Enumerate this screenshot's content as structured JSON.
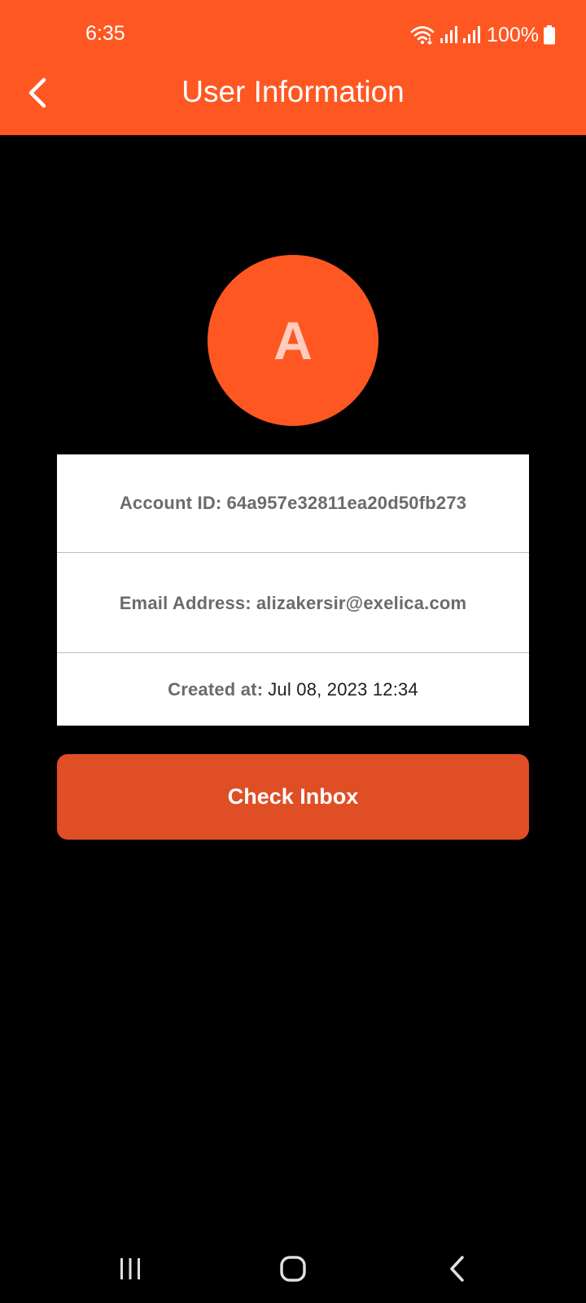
{
  "status_bar": {
    "time": "6:35",
    "battery_percent": "100%"
  },
  "app_bar": {
    "title": "User Information",
    "back_icon": "chevron-left-icon"
  },
  "avatar": {
    "letter": "A"
  },
  "info": {
    "account_label": "Account ID:",
    "account_value": "64a957e32811ea20d50fb273",
    "email_label": "Email Address:",
    "email_value": "alizakersir@exelica.com",
    "created_label": "Created at:",
    "created_value": "Jul 08, 2023 12:34"
  },
  "actions": {
    "check_inbox_label": "Check Inbox"
  },
  "nav_bar": {
    "icons": [
      "recent-apps-icon",
      "home-icon",
      "back-icon"
    ]
  },
  "colors": {
    "primary": "#FF5722",
    "button": "#E04E25",
    "avatar_text": "#FFCCBC",
    "background": "#000000",
    "card": "#FFFFFF"
  }
}
